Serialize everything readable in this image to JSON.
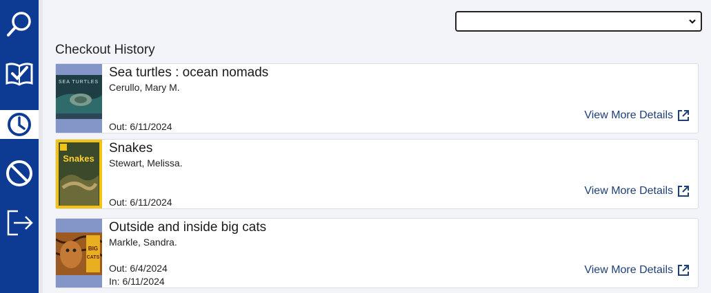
{
  "sidebar": {
    "items": [
      {
        "icon": "search-icon"
      },
      {
        "icon": "checklist-book-icon"
      },
      {
        "icon": "clock-icon",
        "active": true
      },
      {
        "icon": "blocked-icon"
      },
      {
        "icon": "logout-icon"
      }
    ]
  },
  "filter_select": {
    "value": ""
  },
  "page_title": "Checkout History",
  "checkouts": [
    {
      "title": "Sea turtles : ocean nomads",
      "author": "Cerullo, Mary M.",
      "out": "Out: 6/11/2024",
      "in": "",
      "link": "View More Details",
      "cover_text": "SEA TURTLES"
    },
    {
      "title": "Snakes",
      "author": "Stewart, Melissa.",
      "out": "Out: 6/11/2024",
      "in": "",
      "link": "View More Details",
      "cover_text": "Snakes"
    },
    {
      "title": "Outside and inside big cats",
      "author": "Markle, Sandra.",
      "out": "Out: 6/4/2024",
      "in": "In: 6/11/2024",
      "link": "View More Details",
      "cover_text": "BIG CATS"
    }
  ],
  "colors": {
    "sidebar": "#0d3b94",
    "link": "#1d3f78",
    "background": "#f3f4f9"
  }
}
